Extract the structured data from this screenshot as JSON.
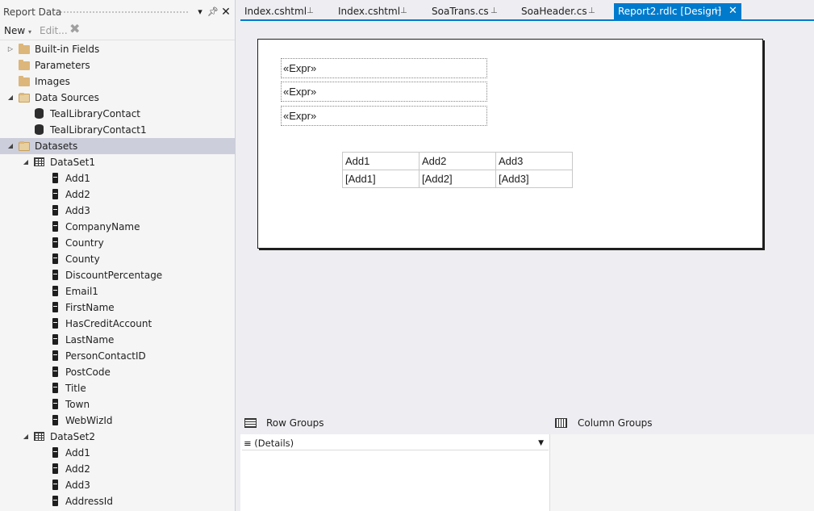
{
  "panel": {
    "title": "Report Data",
    "toolbar": {
      "new_label": "New",
      "edit_label": "Edit..."
    }
  },
  "tree": {
    "builtin": "Built-in Fields",
    "parameters": "Parameters",
    "images": "Images",
    "data_sources": "Data Sources",
    "sources": [
      "TealLibraryContact",
      "TealLibraryContact1"
    ],
    "datasets": "Datasets",
    "dataset1": {
      "name": "DataSet1",
      "fields": [
        "Add1",
        "Add2",
        "Add3",
        "CompanyName",
        "Country",
        "County",
        "DiscountPercentage",
        "Email1",
        "FirstName",
        "HasCreditAccount",
        "LastName",
        "PersonContactID",
        "PostCode",
        "Title",
        "Town",
        "WebWizId"
      ]
    },
    "dataset2": {
      "name": "DataSet2",
      "fields": [
        "Add1",
        "Add2",
        "Add3",
        "AddressId"
      ]
    }
  },
  "tabs": [
    {
      "label": "Index.cshtml",
      "active": false
    },
    {
      "label": "Index.cshtml",
      "active": false
    },
    {
      "label": "SoaTrans.cs",
      "active": false
    },
    {
      "label": "SoaHeader.cs",
      "active": false
    },
    {
      "label": "Report2.rdlc [Design]",
      "active": true
    }
  ],
  "report": {
    "textboxes": [
      "«Expr»",
      "«Expr»",
      "«Expr»"
    ],
    "table": {
      "headers": [
        "Add1",
        "Add2",
        "Add3"
      ],
      "details": [
        "[Add1]",
        "[Add2]",
        "[Add3]"
      ]
    }
  },
  "groups": {
    "row_groups_label": "Row Groups",
    "column_groups_label": "Column Groups",
    "details_label": "(Details)"
  },
  "colors": {
    "accent": "#007acc",
    "selected_row": "#cccedb",
    "panel_bg": "#f5f5f5"
  }
}
